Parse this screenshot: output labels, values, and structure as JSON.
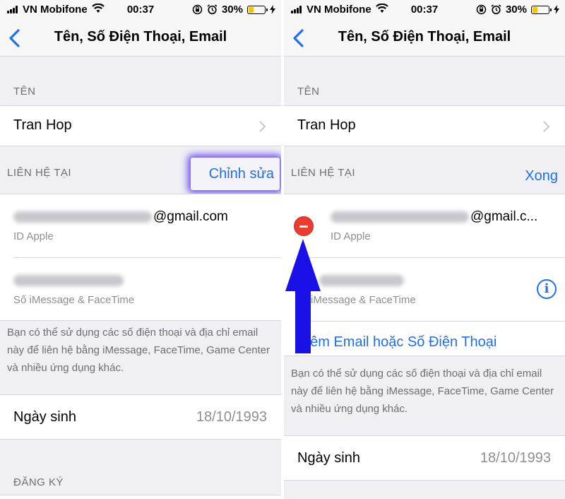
{
  "screens": [
    {
      "status": {
        "carrier": "VN Mobifone",
        "time": "00:37",
        "battery": "30%"
      },
      "nav": {
        "title": "Tên, Số Điện Thoại, Email"
      },
      "name_section": {
        "header": "TÊN",
        "value": "Tran Hop"
      },
      "contact_section": {
        "header": "LIÊN HỆ TẠI",
        "action": "Chỉnh sửa"
      },
      "email": {
        "suffix": "@gmail.com",
        "sub": "ID Apple"
      },
      "phone": {
        "sub": "Số iMessage & FaceTime"
      },
      "footer": "Bạn có thể sử dụng các số điện thoại và địa chỉ email này để liên hệ bằng iMessage, FaceTime, Game Center và nhiều ứng dụng khác.",
      "birthday": {
        "label": "Ngày sinh",
        "value": "18/10/1993"
      },
      "register_header": "ĐĂNG KÝ"
    },
    {
      "status": {
        "carrier": "VN Mobifone",
        "time": "00:37",
        "battery": "30%"
      },
      "nav": {
        "title": "Tên, Số Điện Thoại, Email"
      },
      "name_section": {
        "header": "TÊN",
        "value": "Tran Hop"
      },
      "contact_section": {
        "header": "LIÊN HỆ TẠI",
        "action": "Xong"
      },
      "email": {
        "suffix": "@gmail.c...",
        "sub": "ID Apple"
      },
      "phone": {
        "sub": "iMessage & FaceTime"
      },
      "add_link": "hêm Email hoặc Số Điện Thoại",
      "footer": "Bạn có thể sử dụng các số điện thoại và địa chỉ email này để liên hệ bằng iMessage, FaceTime, Game Center và nhiều ứng dụng khác.",
      "birthday": {
        "label": "Ngày sinh",
        "value": "18/10/1993"
      }
    }
  ],
  "icons": {
    "back": "chevron-left-icon",
    "chevron": "chevron-right-icon",
    "info": "info-icon",
    "delete": "delete-circle-icon",
    "arrow": "up-arrow-annotation"
  },
  "colors": {
    "accent": "#1d6ff2",
    "delete": "#ee3b30",
    "arrow": "#1a10e8",
    "glow": "#6b4cf0",
    "battery": "#f7c500"
  }
}
